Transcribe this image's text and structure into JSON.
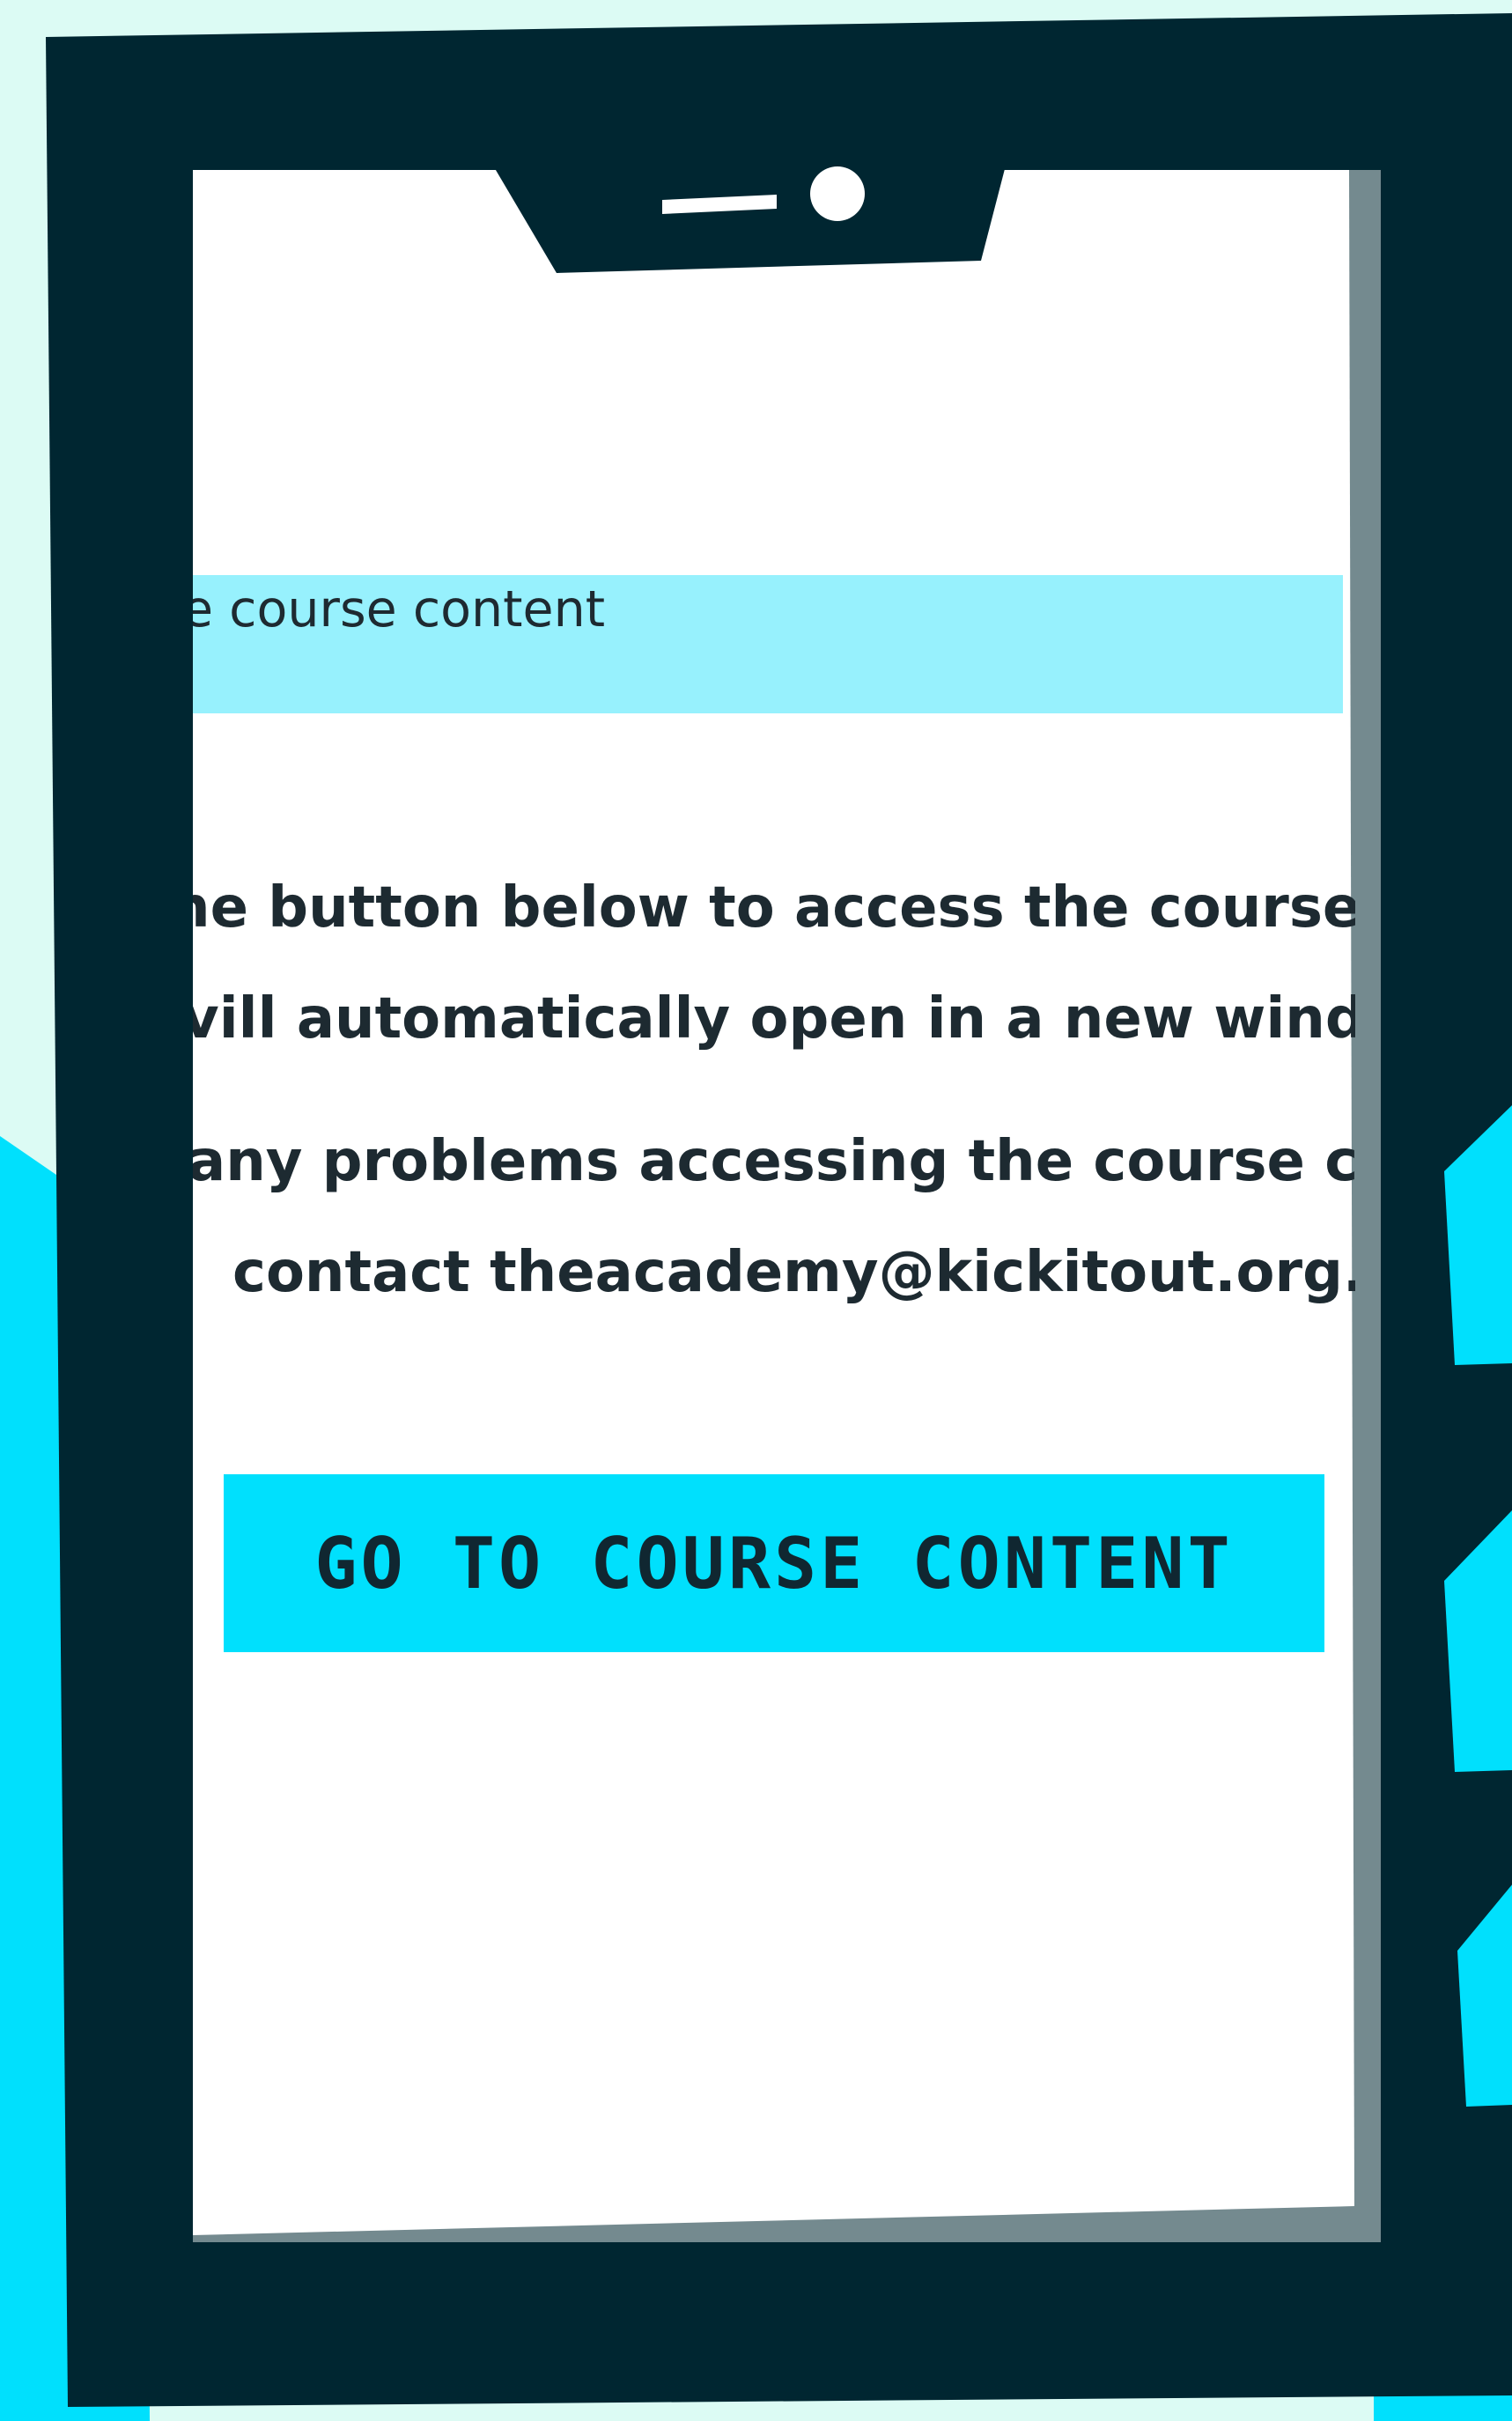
{
  "banner": {
    "text": "e course content"
  },
  "instructions": {
    "line1": "he button below to access the course co",
    "line2": "vill automatically open in a new window",
    "line3": "any problems accessing the course con",
    "line4": "contact theacademy@kickitout.org."
  },
  "cta": {
    "label": "GO TO COURSE CONTENT"
  },
  "colors": {
    "background_mint": "#dcfbf4",
    "background_cyan": "#00e0fd",
    "phone_frame": "#002631",
    "phone_shadow": "#748a8f",
    "screen": "#ffffff",
    "banner": "#97f1fd",
    "text": "#1d2a31"
  }
}
